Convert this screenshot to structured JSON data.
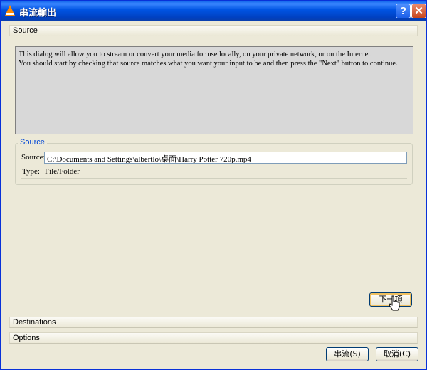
{
  "window": {
    "title": "串流輸出",
    "help_button": "?",
    "close_button": "✕",
    "icon": "vlc-cone-icon"
  },
  "panels": {
    "source_header": "Source",
    "destinations_header": "Destinations",
    "options_header": "Options"
  },
  "intro": {
    "line1": "This dialog will allow you to stream or convert your media for use locally, on your private network, or on the Internet.",
    "line2": "You should start by checking that source matches what you want your input to be and then press the \"Next\" button to continue."
  },
  "source_group": {
    "title": "Source",
    "source_label": "Source:",
    "source_value": "C:\\Documents and Settings\\albertlo\\桌面\\Harry Potter 720p.mp4",
    "type_label": "Type:",
    "type_value": "File/Folder"
  },
  "buttons": {
    "next": "下一項",
    "stream": "串流(S)",
    "cancel": "取消(C)"
  },
  "colors": {
    "titlebar": "#0054e3",
    "dialog_bg": "#ece9d8",
    "group_title": "#0046d5"
  }
}
